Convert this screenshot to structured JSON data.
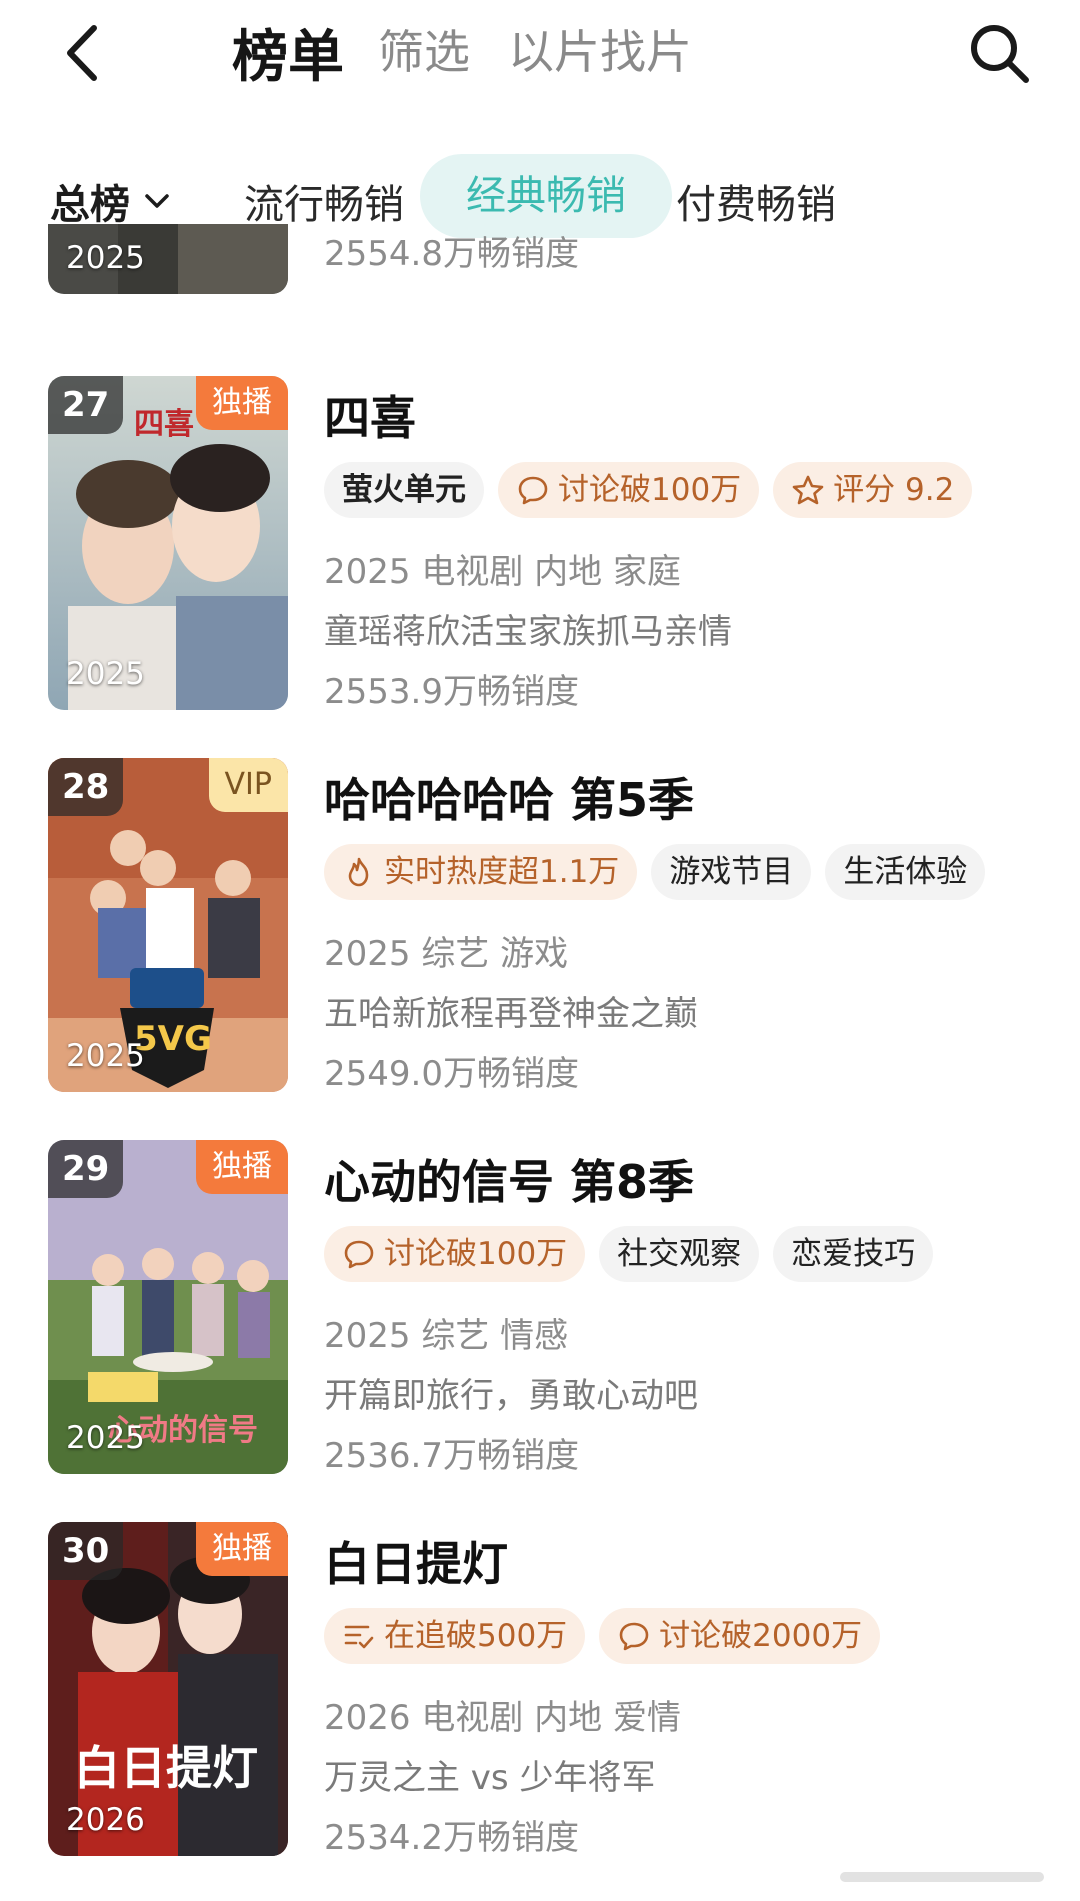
{
  "header": {
    "tabs": [
      "榜单",
      "筛选",
      "以片找片"
    ]
  },
  "category": {
    "dropdown_label": "总榜",
    "tabs": [
      "流行畅销",
      "经典畅销",
      "付费畅销"
    ],
    "active_tab": "经典畅销"
  },
  "partial_item": {
    "year": "2025",
    "sales": "2554.8万畅销度"
  },
  "items": [
    {
      "rank": "27",
      "badge": "独播",
      "year": "2025",
      "title": "四喜",
      "tags": [
        "萤火单元",
        "讨论破100万",
        "评分 9.2"
      ],
      "meta": "2025 电视剧 内地 家庭",
      "desc": "童瑶蒋欣活宝家族抓马亲情",
      "sales": "2553.9万畅销度"
    },
    {
      "rank": "28",
      "badge": "VIP",
      "year": "2025",
      "title": "哈哈哈哈哈 第5季",
      "tags": [
        "实时热度超1.1万",
        "游戏节目",
        "生活体验"
      ],
      "meta": "2025 综艺 游戏",
      "desc": "五哈新旅程再登神金之巅",
      "sales": "2549.0万畅销度"
    },
    {
      "rank": "29",
      "badge": "独播",
      "year": "2025",
      "title": "心动的信号 第8季",
      "tags": [
        "讨论破100万",
        "社交观察",
        "恋爱技巧"
      ],
      "meta": "2025 综艺 情感",
      "desc": "开篇即旅行，勇敢心动吧",
      "sales": "2536.7万畅销度"
    },
    {
      "rank": "30",
      "badge": "独播",
      "year": "2026",
      "title": "白日提灯",
      "tags": [
        "在追破500万",
        "讨论破2000万"
      ],
      "meta": "2026 电视剧 内地 爱情",
      "desc": "万灵之主 vs 少年将军",
      "sales": "2534.2万畅销度"
    }
  ],
  "icons": {
    "back": "chevron-left-icon",
    "search": "search-icon",
    "dropdown": "chevron-down-icon",
    "comment": "comment-bubble-icon",
    "star": "star-outline-icon",
    "flame": "flame-icon",
    "follow": "follow-list-icon"
  },
  "colors": {
    "accent": "#3bbab0",
    "accent_bg": "#e4f4f3",
    "badge_orange": "#f47a3c",
    "badge_vip_bg": "#fbe5a8",
    "tag_warm_bg": "#fbeee4",
    "tag_warm_text": "#b5622a"
  }
}
